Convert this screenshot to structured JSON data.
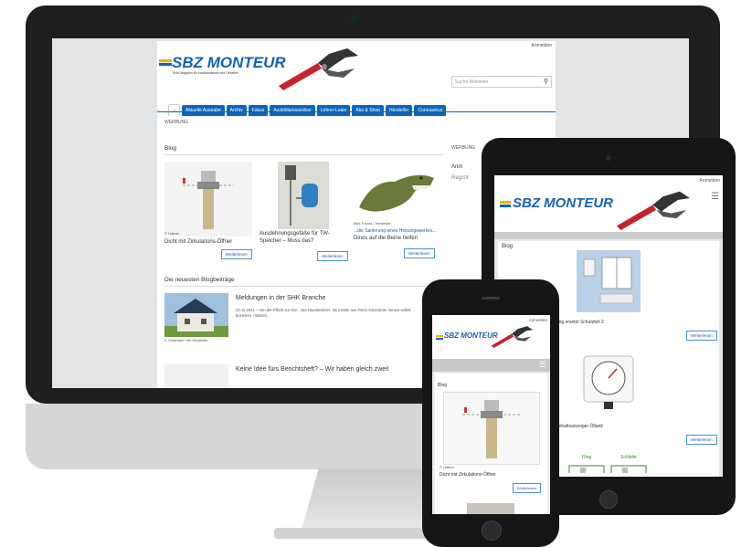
{
  "site": {
    "logo_text": "SBZ MONTEUR",
    "tagline": "SHK-Magazin für Auszubildende und Gesellen",
    "login": "Anmelden",
    "search_placeholder": "Suche Webseite"
  },
  "nav": {
    "tabs": [
      "Aktuelle Ausgabe",
      "Archiv",
      "Fokus",
      "Ausbildungsordner",
      "Lehrer-Login",
      "Abo & Shop",
      "Hersteller",
      "Coronavirus"
    ]
  },
  "desktop": {
    "ad_label": "WERBUNG",
    "blog_title": "Blog",
    "sidebar_title": "WERBUNG",
    "sidebar_login": "Anm",
    "sidebar_register": "Registr",
    "cards": [
      {
        "title": "Dicht mit Zirkulations-Öffner",
        "caption": "© Hafner",
        "button": "Weiterlesen"
      },
      {
        "title": "Ausdehnungsgefäße für TW-Speicher – Muss das?",
        "button": "Weiterlesen"
      },
      {
        "title": "Dinos auf die Beine helfen",
        "link": "...die Sanierung eines Heizungswerkes...",
        "caption": "Bild: Fauna / Hersteller",
        "button": "Weiterlesen"
      }
    ],
    "recent_title": "Die neuesten Blogbeiträge",
    "posts": [
      {
        "title": "Meldungen in der SHK Branche",
        "snippet": "22.11.2021 – Von der Pflicht zur Kür... Die Hausbesitzer, die meiste aus ihrem Solarstrom heraus selbst beziehen, müssen...",
        "caption": "© Solarwatt / ein Hersteller"
      },
      {
        "title": "Keine Idee fürs Berichtsheft? – Wir haben gleich zwei!"
      }
    ]
  },
  "tablet": {
    "login": "Anmelden",
    "blog_title": "Blog",
    "card1_title": "...rung ersetzt Schutzteil 2",
    "card1_button": "Weiterlesen",
    "card2_title": "...r Inhaltsanzeiger Öltank",
    "card2_button": "Weiterlesen",
    "diagram_label_1": "Ring",
    "diagram_label_2": "Schleife"
  },
  "phone": {
    "login": "Anmelden",
    "blog_title": "Blog",
    "card_caption": "© Hafner",
    "card_title": "Dicht mit Zirkulations-Öffner",
    "button": "Weiterlesen"
  },
  "colors": {
    "brand_blue": "#1363b3",
    "nav_blue": "#0f66b8",
    "wrench_red": "#c7232b",
    "device_dark": "#161616"
  }
}
